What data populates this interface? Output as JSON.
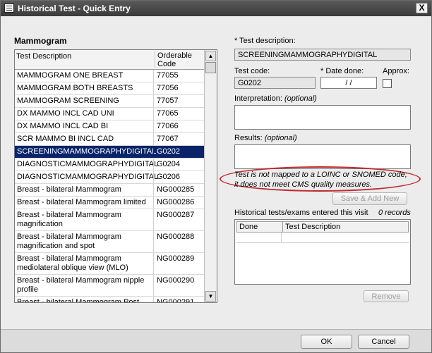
{
  "window": {
    "title": "Historical Test - Quick Entry",
    "close_glyph": "X"
  },
  "section_title": "Mammogram",
  "list": {
    "col1": "Test Description",
    "col2": "Orderable Code",
    "rows": [
      {
        "desc": "MAMMOGRAM ONE BREAST",
        "code": "77055"
      },
      {
        "desc": "MAMMOGRAM BOTH BREASTS",
        "code": "77056"
      },
      {
        "desc": "MAMMOGRAM SCREENING",
        "code": "77057"
      },
      {
        "desc": "DX MAMMO INCL CAD UNI",
        "code": "77065"
      },
      {
        "desc": "DX MAMMO INCL CAD BI",
        "code": "77066"
      },
      {
        "desc": "SCR MAMMO BI INCL CAD",
        "code": "77067"
      },
      {
        "desc": "SCREENINGMAMMOGRAPHYDIGITAL",
        "code": "G0202",
        "selected": true
      },
      {
        "desc": "DIAGNOSTICMAMMOGRAPHYDIGITAL",
        "code": "G0204"
      },
      {
        "desc": "DIAGNOSTICMAMMOGRAPHYDIGITAL",
        "code": "G0206"
      },
      {
        "desc": "Breast - bilateral Mammogram",
        "code": "NG000285"
      },
      {
        "desc": "Breast - bilateral Mammogram limited",
        "code": "NG000286"
      },
      {
        "desc": "Breast - bilateral Mammogram magnification",
        "code": "NG000287"
      },
      {
        "desc": "Breast - bilateral Mammogram magnification and spot",
        "code": "NG000288"
      },
      {
        "desc": "Breast - bilateral Mammogram mediolateral oblique view (MLO)",
        "code": "NG000289"
      },
      {
        "desc": "Breast - bilateral Mammogram nipple profile",
        "code": "NG000290"
      },
      {
        "desc": "Breast - bilateral Mammogram Post Wire Placement",
        "code": "NG000291"
      }
    ]
  },
  "form": {
    "test_description_label": "* Test description:",
    "test_description_value": "SCREENINGMAMMOGRAPHYDIGITAL",
    "test_code_label": "Test code:",
    "test_code_value": "G0202",
    "date_done_label": "* Date done:",
    "date_done_value": "/ /",
    "approx_label": "Approx:",
    "interpretation_label": "Interpretation:",
    "interpretation_optional": "(optional)",
    "results_label": "Results:",
    "results_optional": "(optional)",
    "note_line1": "Test is not mapped to a LOINC or SNOMED code;",
    "note_line2": "it does not meet CMS quality measures.",
    "save_add_new_label": "Save & Add New"
  },
  "history": {
    "label": "Historical tests/exams entered this visit",
    "count": "0 records",
    "col_done": "Done",
    "col_desc": "Test Description",
    "remove_label": "Remove"
  },
  "footer": {
    "ok_label": "OK",
    "cancel_label": "Cancel"
  }
}
